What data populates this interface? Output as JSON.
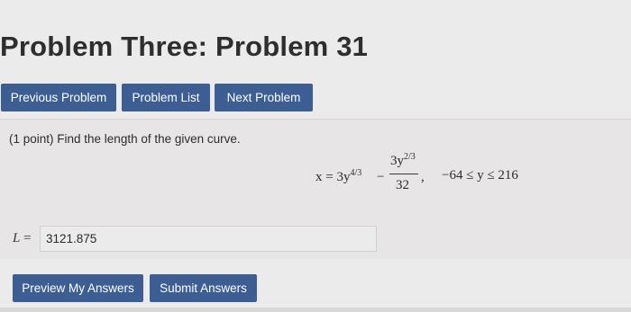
{
  "title": "Problem Three: Problem 31",
  "nav": {
    "previous_label": "Previous Problem",
    "list_label": "Problem List",
    "next_label": "Next Problem"
  },
  "problem": {
    "prompt": "(1 point) Find the length of the given curve.",
    "equation": {
      "lhs": "x = 3y",
      "lhs_exp": "4/3",
      "minus": "−",
      "num": "3y",
      "num_exp": "2/3",
      "den": "32",
      "comma": ",",
      "range": "−64 ≤ y ≤ 216"
    }
  },
  "answer": {
    "label_var": "L",
    "label_eq": "=",
    "value": "3121.875"
  },
  "actions": {
    "preview_label": "Preview My Answers",
    "submit_label": "Submit Answers"
  },
  "colors": {
    "primary_button": "#3c5e93",
    "background": "#ecebeb"
  }
}
